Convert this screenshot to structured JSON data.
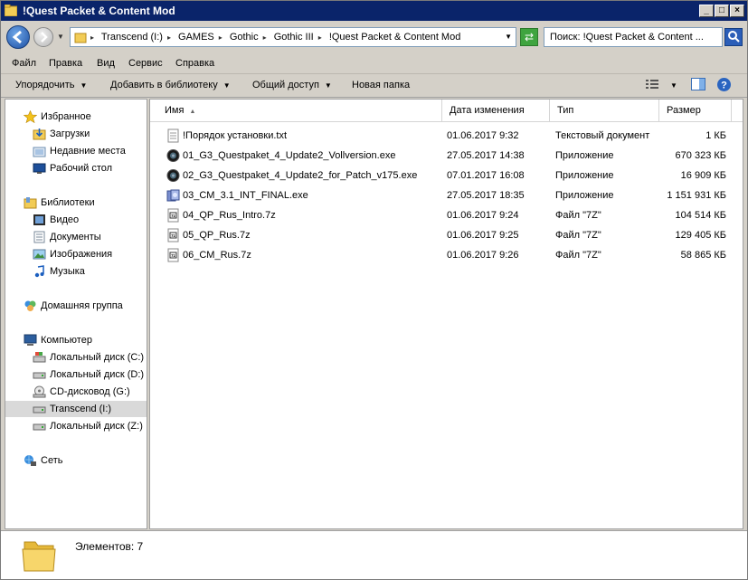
{
  "window": {
    "title": "!Quest Packet & Content Mod"
  },
  "address": {
    "crumbs": [
      "Transcend (I:)",
      "GAMES",
      "Gothic",
      "Gothic III",
      "!Quest Packet & Content Mod"
    ],
    "search_placeholder": "Поиск: !Quest Packet & Content ..."
  },
  "menu": [
    "Файл",
    "Правка",
    "Вид",
    "Сервис",
    "Справка"
  ],
  "toolbar": {
    "organize": "Упорядочить",
    "add_library": "Добавить в библиотеку",
    "share": "Общий доступ",
    "new_folder": "Новая папка"
  },
  "nav": {
    "favorites": "Избранное",
    "downloads": "Загрузки",
    "recent": "Недавние места",
    "desktop": "Рабочий стол",
    "libraries": "Библиотеки",
    "video": "Видео",
    "documents": "Документы",
    "images": "Изображения",
    "music": "Музыка",
    "homegroup": "Домашняя группа",
    "computer": "Компьютер",
    "disk_c": "Локальный диск (C:)",
    "disk_d": "Локальный диск (D:)",
    "cd_g": "CD-дисковод (G:)",
    "transcend_i": "Transcend (I:)",
    "disk_z": "Локальный диск (Z:)",
    "network": "Сеть"
  },
  "columns": {
    "name": "Имя",
    "date": "Дата изменения",
    "type": "Тип",
    "size": "Размер"
  },
  "files": [
    {
      "name": "!Порядок установки.txt",
      "date": "01.06.2017 9:32",
      "type": "Текстовый документ",
      "size": "1 КБ",
      "icon": "text-file-icon"
    },
    {
      "name": "01_G3_Questpaket_4_Update2_Vollversion.exe",
      "date": "27.05.2017 14:38",
      "type": "Приложение",
      "size": "670 323 КБ",
      "icon": "gothic-exe-icon"
    },
    {
      "name": "02_G3_Questpaket_4_Update2_for_Patch_v175.exe",
      "date": "07.01.2017 16:08",
      "type": "Приложение",
      "size": "16 909 КБ",
      "icon": "gothic-exe-icon"
    },
    {
      "name": "03_CM_3.1_INT_FINAL.exe",
      "date": "27.05.2017 18:35",
      "type": "Приложение",
      "size": "1 151 931 КБ",
      "icon": "installer-exe-icon"
    },
    {
      "name": "04_QP_Rus_Intro.7z",
      "date": "01.06.2017 9:24",
      "type": "Файл \"7Z\"",
      "size": "104 514 КБ",
      "icon": "archive-7z-icon"
    },
    {
      "name": "05_QP_Rus.7z",
      "date": "01.06.2017 9:25",
      "type": "Файл \"7Z\"",
      "size": "129 405 КБ",
      "icon": "archive-7z-icon"
    },
    {
      "name": "06_CM_Rus.7z",
      "date": "01.06.2017 9:26",
      "type": "Файл \"7Z\"",
      "size": "58 865 КБ",
      "icon": "archive-7z-icon"
    }
  ],
  "details": {
    "count": "Элементов: 7"
  }
}
